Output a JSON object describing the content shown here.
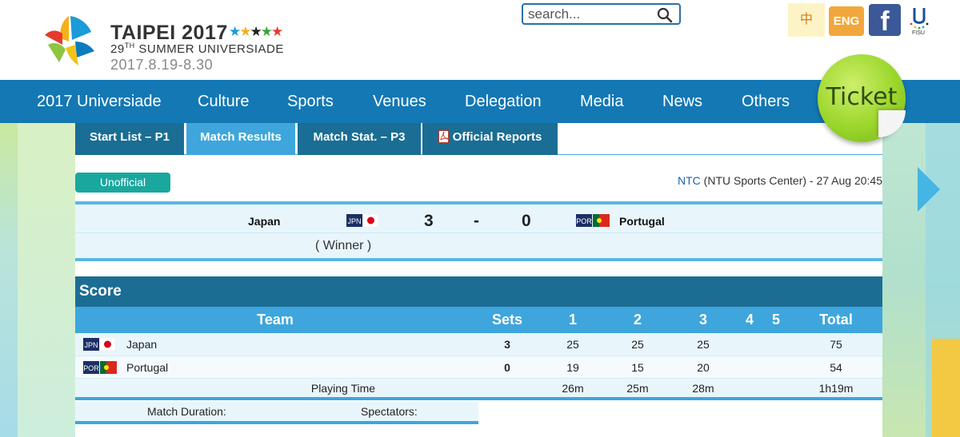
{
  "header": {
    "logo_title": "TAIPEI 2017",
    "logo_sub_num": "29",
    "logo_sub_ord": "TH",
    "logo_sub_text": " SUMMER UNIVERSIADE",
    "logo_date": "2017.8.19-8.30",
    "search_placeholder": "search...",
    "lang_zh": "中",
    "lang_en": "ENG",
    "facebook_glyph": "f",
    "fisu_label": "FISU"
  },
  "nav": {
    "items": [
      "2017 Universiade",
      "Culture",
      "Sports",
      "Venues",
      "Delegation",
      "Media",
      "News",
      "Others"
    ],
    "ticket": "Ticket"
  },
  "tabs": [
    "Start List – P1",
    "Match Results",
    "Match Stat. – P3",
    "Official Reports"
  ],
  "match": {
    "status": "Unofficial",
    "venue_code": "NTC",
    "venue_rest": " (NTU Sports Center) - 27 Aug 20:45",
    "home": "Japan",
    "home_code": "JPN",
    "away": "Portugal",
    "away_code": "POR",
    "home_sets": "3",
    "separator": "-",
    "away_sets": "0",
    "winner_note": "( Winner )"
  },
  "score": {
    "title": "Score",
    "columns": [
      "Team",
      "Sets",
      "1",
      "2",
      "3",
      "4",
      "5",
      "Total"
    ],
    "rows": [
      {
        "code": "JPN",
        "team": "Japan",
        "sets": "3",
        "s1": "25",
        "s2": "25",
        "s3": "25",
        "s4": "",
        "s5": "",
        "total": "75"
      },
      {
        "code": "POR",
        "team": "Portugal",
        "sets": "0",
        "s1": "19",
        "s2": "15",
        "s3": "20",
        "s4": "",
        "s5": "",
        "total": "54"
      }
    ],
    "playing_time": {
      "label": "Playing Time",
      "s1": "26m",
      "s2": "25m",
      "s3": "28m",
      "total": "1h19m"
    }
  },
  "footer": {
    "duration_label": "Match Duration:",
    "spectators_label": "Spectators:"
  },
  "colors": {
    "nav_bg": "#1478b4",
    "tab_bg": "#1a6d94",
    "tab_active": "#3ea6dc",
    "status_badge": "#1aa79e",
    "ticket_green": "#9bd62b"
  }
}
